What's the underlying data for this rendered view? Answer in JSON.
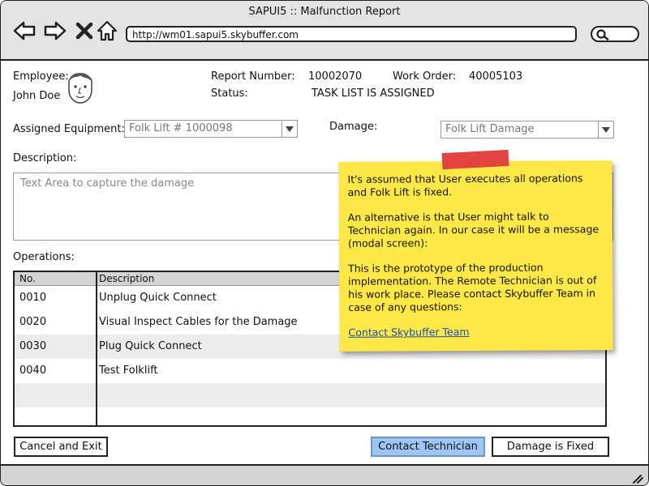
{
  "window": {
    "title": "SAPUI5 :: Malfunction Report",
    "url": "http://wm01.sapui5.skybuffer.com"
  },
  "header": {
    "employee_label": "Employee:",
    "employee_name": "John Doe",
    "report_number_label": "Report Number:",
    "report_number": "10002070",
    "work_order_label": "Work Order:",
    "work_order": "40005103",
    "status_label": "Status:",
    "status": "TASK LIST IS ASSIGNED"
  },
  "form": {
    "equipment_label": "Assigned Equipment:",
    "equipment_value": "Folk Lift # 1000098",
    "damage_label": "Damage:",
    "damage_value": "Folk Lift Damage",
    "description_label": "Description:",
    "description_placeholder": "Text Area to capture the damage"
  },
  "operations": {
    "label": "Operations:",
    "columns": [
      "No.",
      "Description"
    ],
    "rows": [
      {
        "no": "0010",
        "description": "Unplug Quick Connect"
      },
      {
        "no": "0020",
        "description": "Visual Inspect Cables for the Damage"
      },
      {
        "no": "0030",
        "description": "Plug Quick Connect"
      },
      {
        "no": "0040",
        "description": "Test Folklift"
      }
    ]
  },
  "buttons": {
    "cancel": "Cancel and Exit",
    "contact": "Contact Technician",
    "fixed": "Damage is Fixed"
  },
  "note": {
    "p1": "It's assumed that User executes all operations and Folk Lift is fixed.",
    "p2": "An alternative is that User might talk to Technician again. In our case it will be a message (modal screen):",
    "p3": "This is the prototype of the production implementation. The Remote Technician is out of his work place. Please contact Skybuffer Team in case of any questions:",
    "link": "Contact Skybuffer Team",
    "background_color": "#fde847"
  },
  "icons": [
    "back-arrow-icon",
    "forward-arrow-icon",
    "close-icon",
    "home-icon",
    "search-icon",
    "avatar",
    "chevron-down-icon",
    "resize-grip-icon"
  ]
}
